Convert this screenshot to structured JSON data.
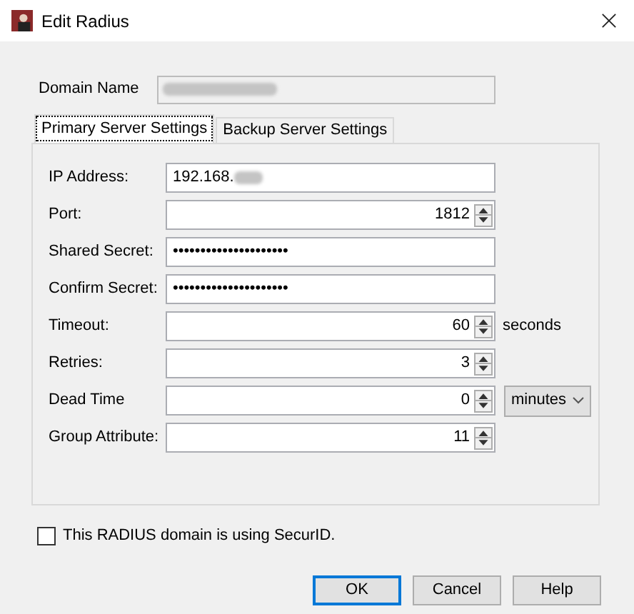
{
  "window": {
    "title": "Edit Radius"
  },
  "domain": {
    "label": "Domain Name",
    "blurred": true,
    "disabled": true
  },
  "tabs": [
    {
      "label": "Primary Server Settings",
      "selected": true
    },
    {
      "label": "Backup Server Settings",
      "selected": false
    }
  ],
  "fields": [
    {
      "label": "IP Address:",
      "kind": "text",
      "value": "192.168.",
      "blurred": true
    },
    {
      "label": "Port:",
      "kind": "spin",
      "value": "1812"
    },
    {
      "label": "Shared Secret:",
      "kind": "password",
      "value": "•••••••••••••••••••••"
    },
    {
      "label": "Confirm Secret:",
      "kind": "password",
      "value": "•••••••••••••••••••••"
    },
    {
      "label": "Timeout:",
      "kind": "spin",
      "value": "60",
      "suffix": "seconds"
    },
    {
      "label": "Retries:",
      "kind": "spin",
      "value": "3"
    },
    {
      "label": "Dead Time",
      "kind": "spin",
      "value": "0",
      "unit": "minutes"
    },
    {
      "label": "Group Attribute:",
      "kind": "spin",
      "value": "11"
    }
  ],
  "securid": {
    "label": "This RADIUS domain is using SecurID.",
    "checked": false
  },
  "buttons": [
    {
      "label": "OK",
      "selected": true
    },
    {
      "label": "Cancel",
      "selected": false
    },
    {
      "label": "Help",
      "selected": false
    }
  ]
}
